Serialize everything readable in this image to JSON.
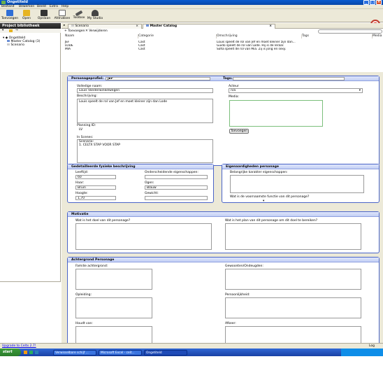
{
  "window": {
    "title": "Ongetiteld"
  },
  "menu": [
    "Bestand",
    "Bewerken",
    "Beeld",
    "Extra",
    "Help"
  ],
  "toolbar": [
    {
      "label": "Toevoegen",
      "icon": "add-icon",
      "color": "#2f6fd6"
    },
    {
      "label": "Open",
      "icon": "folder-icon",
      "color": "#e6b422"
    },
    {
      "label": "Opslaan",
      "icon": "save-icon",
      "color": "#333333"
    },
    {
      "label": "Afdrukken",
      "icon": "printer-icon",
      "color": "#777777"
    },
    {
      "label": "Toolbox",
      "icon": "toolbox-icon",
      "color": "#555555"
    },
    {
      "label": "My Studio",
      "icon": "studio-icon",
      "color": "#444444"
    }
  ],
  "sidebar": {
    "title": "Project bibliotheek",
    "tree": [
      {
        "label": "Ongetiteld",
        "level": 0
      },
      {
        "label": "Master Catalog (3)",
        "level": 1
      },
      {
        "label": "Scenario",
        "level": 1
      }
    ]
  },
  "tabs": [
    {
      "label": "Scenario",
      "active": false
    },
    {
      "label": "Master Catalog",
      "active": true
    }
  ],
  "actions": {
    "add": "Toevoegen",
    "remove": "Verwijderen"
  },
  "grid": {
    "columns": [
      "Naam",
      "Categorie",
      "Omschrijving",
      "Tags",
      "Media"
    ],
    "rows": [
      [
        "JEF",
        "Cast",
        "Louis speelt de rol van Jef en moet kleiner zijn dan...",
        "",
        ""
      ],
      [
        "LODE",
        "Cast",
        "Guido speelt de rol van Lode. Hij is de leraar.",
        "",
        ""
      ],
      [
        "MIA",
        "Cast",
        "Sofia speelt de rol van Mia. Zij is jong en sexy.",
        "",
        ""
      ]
    ]
  },
  "profile": {
    "header_label": "Personageprofiel:",
    "header_value": "JEF",
    "tags_label": "Tags:",
    "fullname_label": "Volledige naam:",
    "fullname_value": "Louis Vanderwinkelwegen",
    "description_label": "Beschrijving:",
    "description_value": "Louis speelt de rol van Jef en moet kleiner zijn dan Lode",
    "planning_label": "Planning ID:",
    "planning_value": "LV",
    "scenes_label": "In Scenes:",
    "scenes_value": "Scenario:",
    "scenes_item": "1. CELTX STAP VOOR STAP",
    "actor_label": "Acteur",
    "actor_value": "n/a",
    "media_label": "Media:",
    "add_media": "Toevoegen"
  },
  "physical": {
    "title": "Gedetailleerde fysieke beschrijving",
    "age_label": "Leeftijd:",
    "age_value": "60",
    "features_label": "Onderscheidende eigenschappen:",
    "hair_label": "Haar:",
    "hair_value": "Bruin",
    "eyes_label": "Ogen:",
    "eyes_value": "Blauw",
    "height_label": "Hoogte:",
    "height_value": "1,70",
    "weight_label": "Gewicht:",
    "weight_value": ""
  },
  "traits": {
    "title": "Eigenaardigheden personage",
    "important_label": "Belangrijke karakter eigenschappen:",
    "function_label": "Wat is de voornaamste functie van dit personage?"
  },
  "motivation": {
    "title": "Motivatie",
    "goal_label": "Wat is het doel van dit personage?",
    "plan_label": "Wat is het plan van dit personage om dit doel te bereiken?"
  },
  "background": {
    "title": "Achtergrond Personage",
    "family_label": "Familie achtergrond:",
    "habits_label": "Gewoonten/Ondeugden:",
    "education_label": "Opleiding:",
    "personality_label": "Persoonlijkheid:",
    "likes_label": "Houdt van:",
    "dislikes_label": "Afkeer:"
  },
  "status": {
    "upgrade": "Upgrade to Celtx 2.7!",
    "log": "Log"
  },
  "taskbar": {
    "start": "start",
    "tasks": [
      {
        "label": "Verwisselbare schijf ...",
        "active": false
      },
      {
        "label": "Microsoft Excel - ceit...",
        "active": false
      },
      {
        "label": "Ongetiteld",
        "active": true
      }
    ]
  }
}
